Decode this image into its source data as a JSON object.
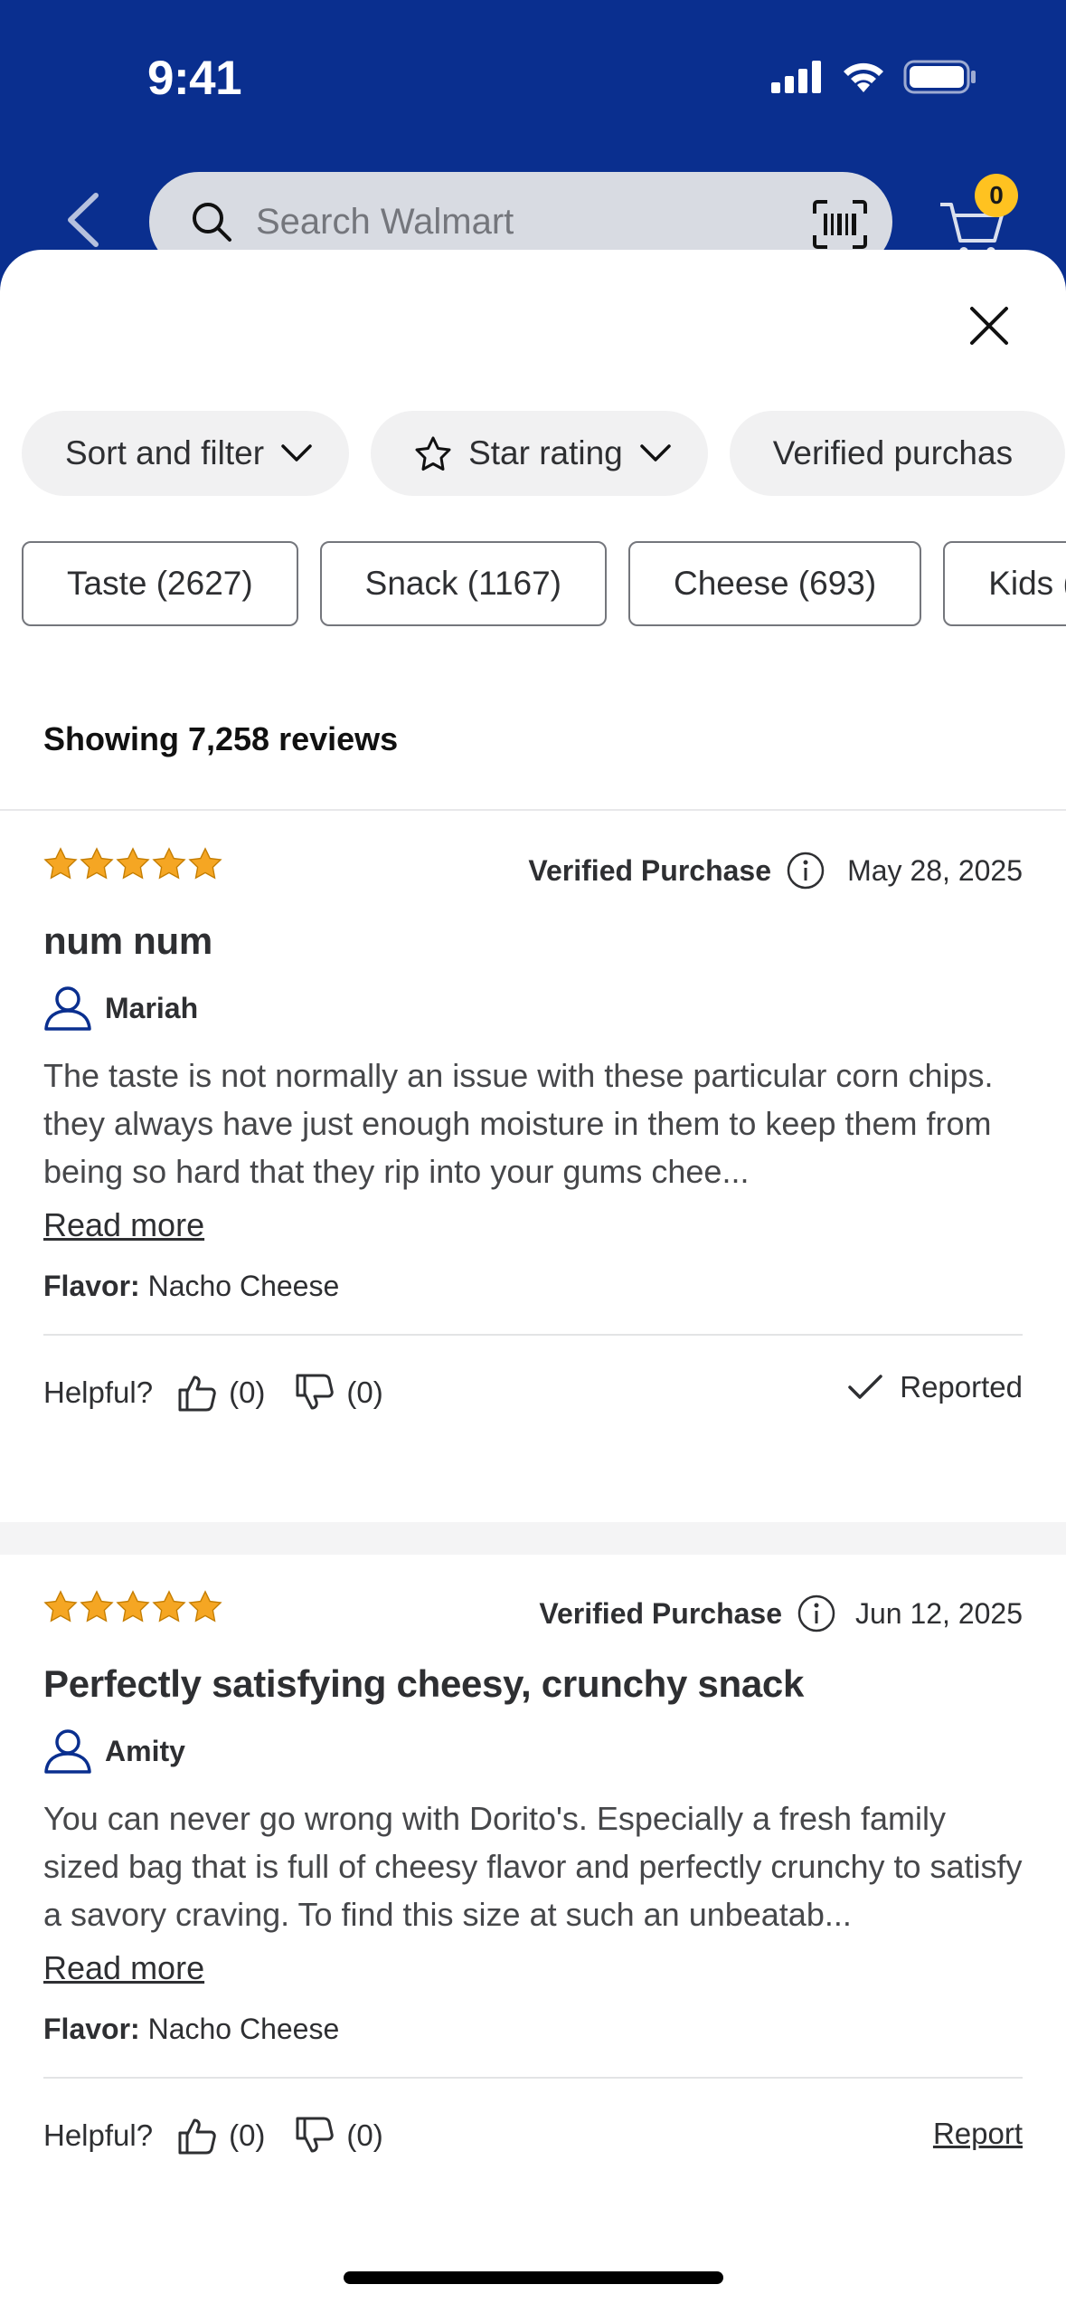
{
  "status_bar": {
    "time": "9:41"
  },
  "header": {
    "search_placeholder": "Search Walmart",
    "cart_count": "0"
  },
  "filters": {
    "chips": [
      {
        "label": "Sort and filter"
      },
      {
        "label": "Star rating"
      },
      {
        "label": "Verified purchas"
      }
    ],
    "tags": [
      {
        "label": "Taste (2627)"
      },
      {
        "label": "Snack (1167)"
      },
      {
        "label": "Cheese (693)"
      },
      {
        "label": "Kids (4"
      }
    ]
  },
  "summary": {
    "count_text": "Showing 7,258 reviews"
  },
  "reviews": [
    {
      "rating": 5,
      "verified_label": "Verified Purchase",
      "date": "May 28, 2025",
      "title": "num num",
      "author": "Mariah",
      "body": "The taste is not normally an issue with these particular corn chips. they always have just enough moisture in them to keep them from being so hard that they rip into your gums chee...",
      "read_more": "Read more",
      "flavor_label": "Flavor:",
      "flavor_value": "Nacho Cheese",
      "helpful_label": "Helpful?",
      "up_count": "(0)",
      "down_count": "(0)",
      "report_label": "Reported"
    },
    {
      "rating": 5,
      "verified_label": "Verified Purchase",
      "date": "Jun 12, 2025",
      "title": "Perfectly satisfying cheesy, crunchy snack",
      "author": "Amity",
      "body": "You can never go wrong with Dorito's. Especially a fresh family sized bag that is full of cheesy flavor and perfectly crunchy to satisfy a savory craving. To find this size at such an unbeatab...",
      "read_more": "Read more",
      "flavor_label": "Flavor:",
      "flavor_value": "Nacho Cheese",
      "helpful_label": "Helpful?",
      "up_count": "(0)",
      "down_count": "(0)",
      "report_label": "Report"
    }
  ],
  "colors": {
    "header_bg": "#0a2f8f",
    "star": "#f5a623",
    "badge": "#ffc220",
    "text": "#2e2f32"
  }
}
